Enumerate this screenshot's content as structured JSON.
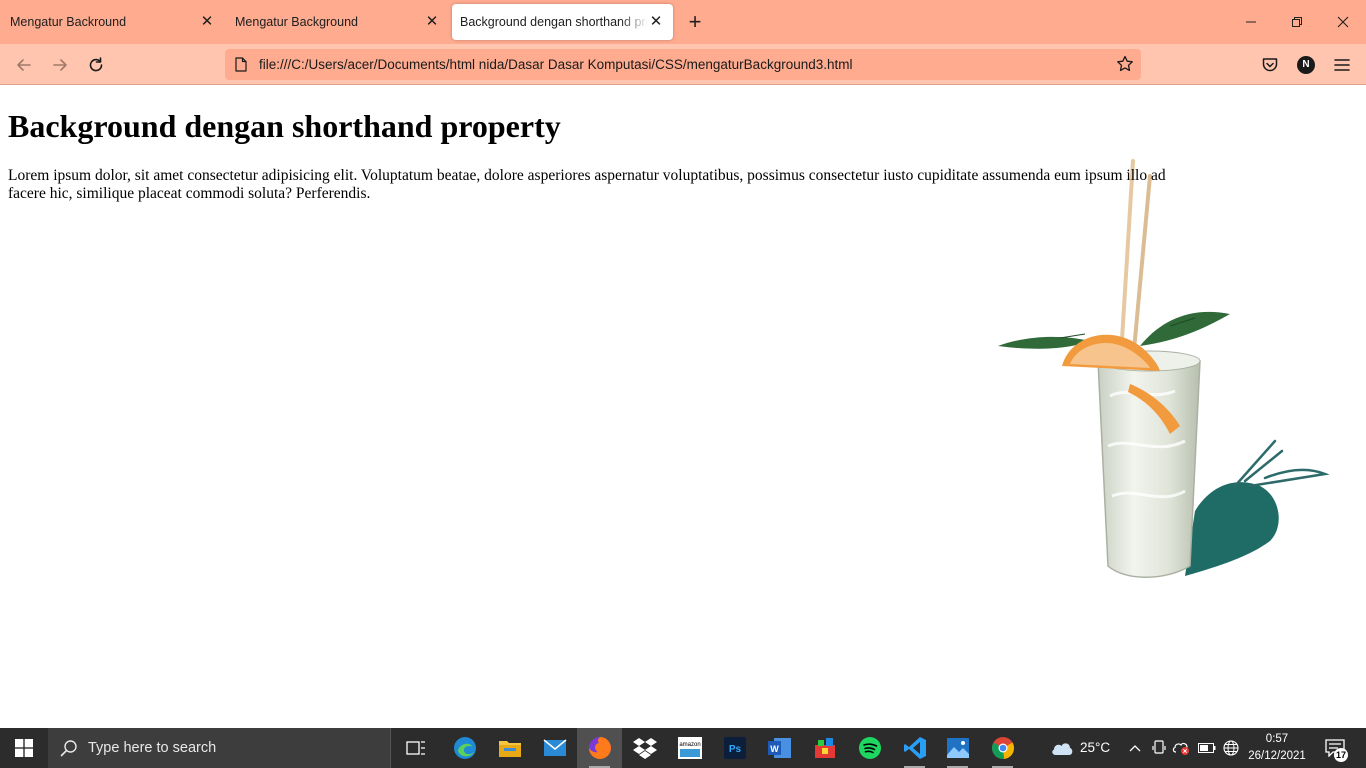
{
  "browser": {
    "tabs": [
      {
        "label": "Mengatur Backround"
      },
      {
        "label": "Mengatur Background"
      },
      {
        "label": "Background dengan shorthand property"
      }
    ],
    "url": "file:///C:/Users/acer/Documents/html nida/Dasar Dasar Komputasi/CSS/mengaturBackground3.html",
    "account_initial": "N",
    "colors": {
      "tabstrip": "#ffab8f",
      "navbar": "#ffc5ae",
      "active_tab": "#ffffff"
    }
  },
  "page": {
    "heading": "Background dengan shorthand property",
    "paragraph": "Lorem ipsum dolor, sit amet consectetur adipisicing elit. Voluptatum beatae, dolore asperiores aspernatur voluptatibus, possimus consectetur iusto cupiditate assumenda eum ipsum illo ad facere hic, similique placeat commodi soluta? Perferendis.",
    "background_image": "cocktail-glass-with-orange-slice-and-straws"
  },
  "taskbar": {
    "search_placeholder": "Type here to search",
    "apps": [
      "task-view",
      "edge",
      "file-explorer",
      "mail",
      "firefox",
      "dropbox",
      "amazon",
      "photoshop",
      "word",
      "app-store",
      "spotify",
      "vscode",
      "photos",
      "chrome"
    ],
    "active_app": "firefox",
    "weather": {
      "icon": "cloud-icon",
      "temperature": "25°C"
    },
    "clock": {
      "time": "0:57",
      "date": "26/12/2021"
    },
    "notifications_count": "17"
  }
}
